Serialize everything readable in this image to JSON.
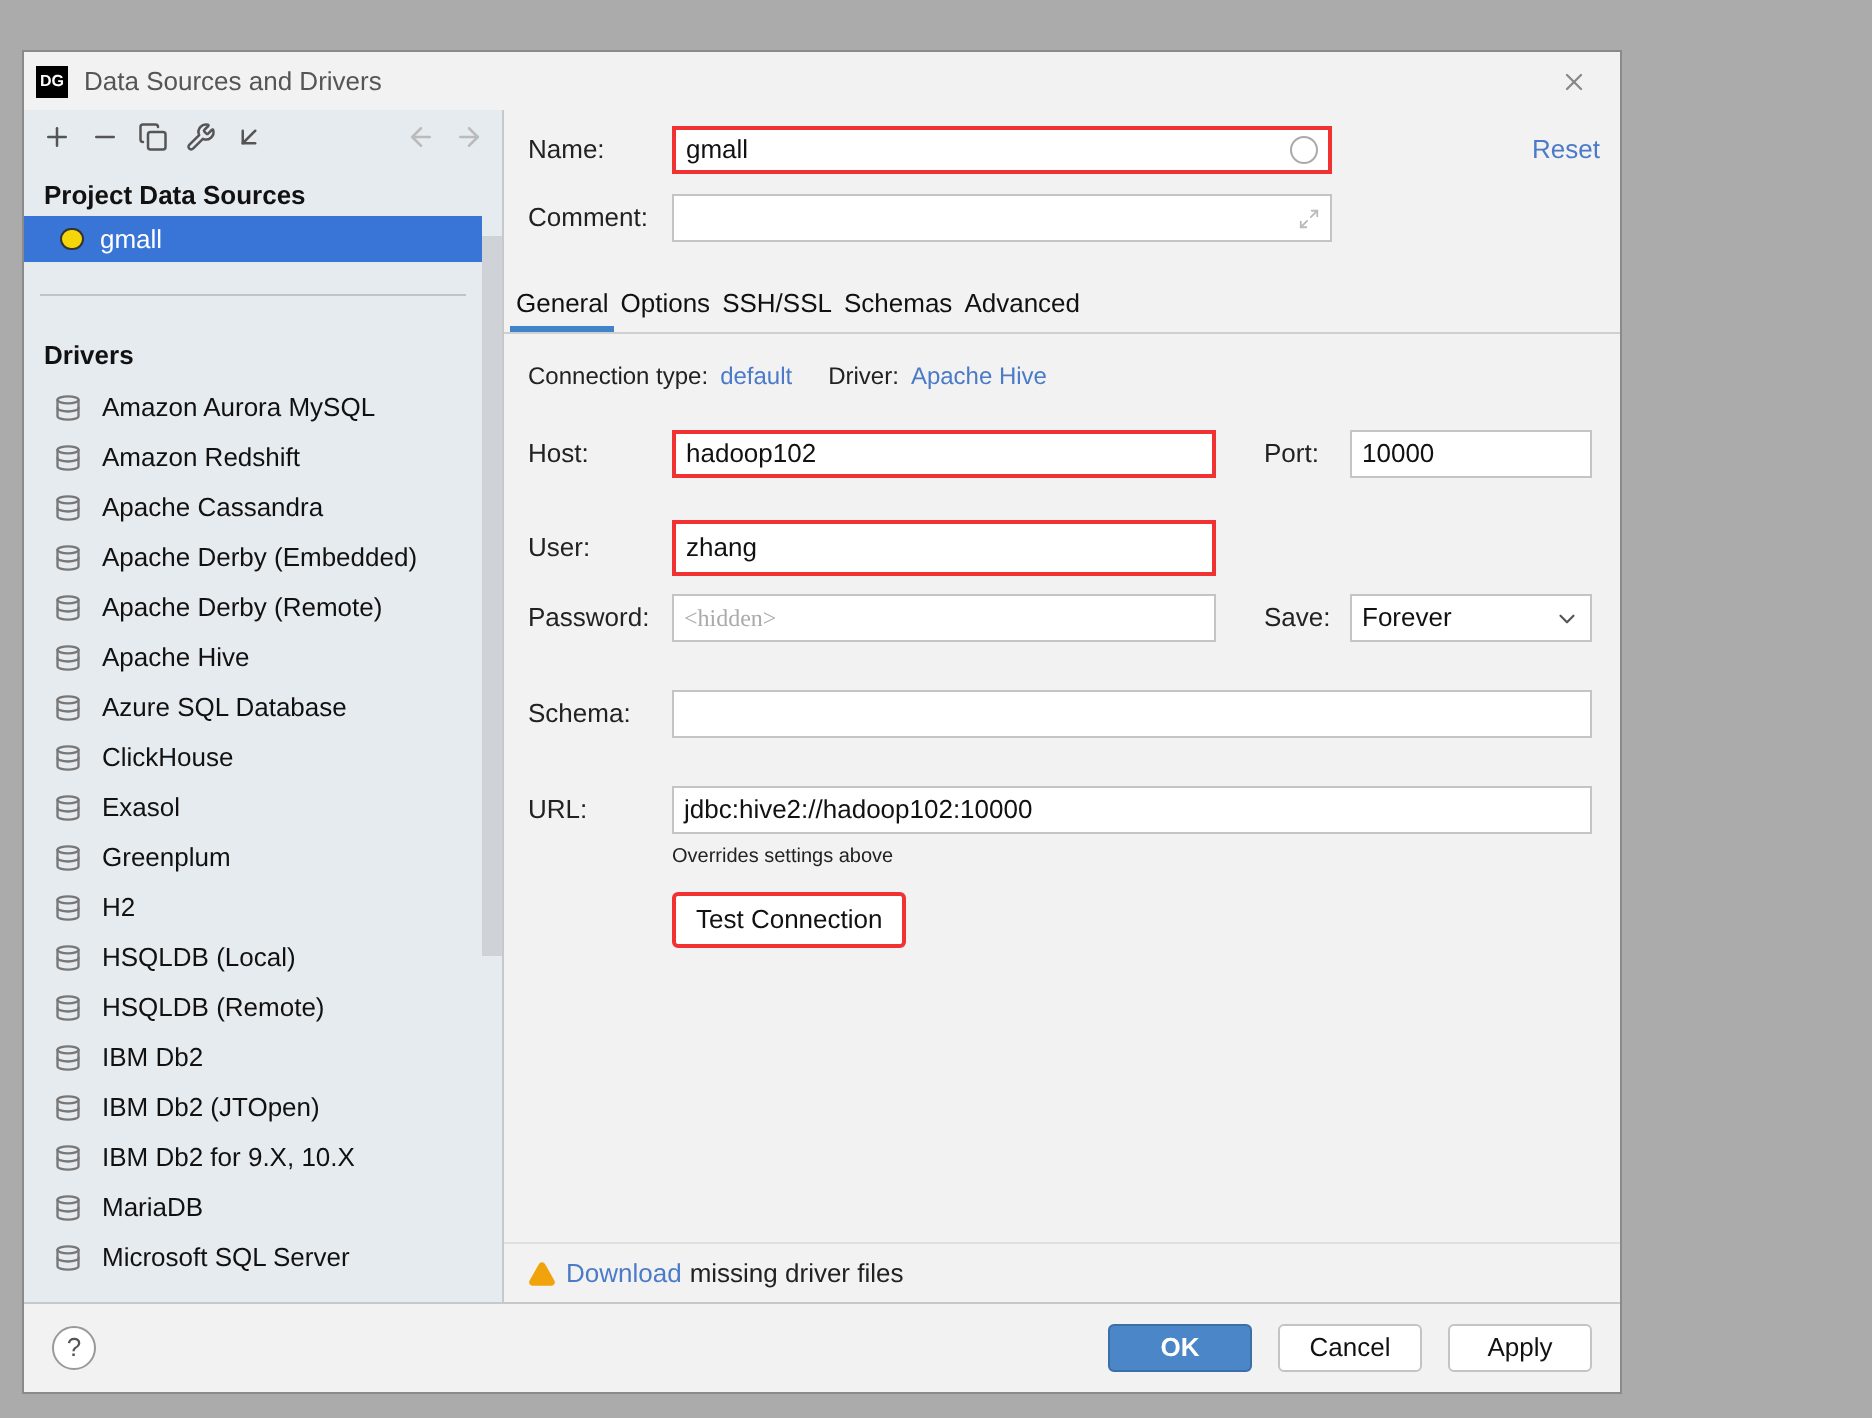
{
  "window": {
    "title": "Data Sources and Drivers",
    "logo": "DG"
  },
  "sidebar": {
    "project_heading": "Project Data Sources",
    "project_items": [
      {
        "label": "gmall",
        "selected": true
      }
    ],
    "drivers_heading": "Drivers",
    "drivers": [
      {
        "label": "Amazon Aurora MySQL"
      },
      {
        "label": "Amazon Redshift"
      },
      {
        "label": "Apache Cassandra"
      },
      {
        "label": "Apache Derby (Embedded)"
      },
      {
        "label": "Apache Derby (Remote)"
      },
      {
        "label": "Apache Hive"
      },
      {
        "label": "Azure SQL Database"
      },
      {
        "label": "ClickHouse"
      },
      {
        "label": "Exasol"
      },
      {
        "label": "Greenplum"
      },
      {
        "label": "H2"
      },
      {
        "label": "HSQLDB (Local)"
      },
      {
        "label": "HSQLDB (Remote)"
      },
      {
        "label": "IBM Db2"
      },
      {
        "label": "IBM Db2 (JTOpen)"
      },
      {
        "label": "IBM Db2 for 9.X, 10.X"
      },
      {
        "label": "MariaDB"
      },
      {
        "label": "Microsoft SQL Server"
      }
    ]
  },
  "form": {
    "name": {
      "label": "Name:",
      "value": "gmall",
      "highlighted": true
    },
    "reset": "Reset",
    "comment": {
      "label": "Comment:"
    },
    "tabs": [
      {
        "label": "General",
        "selected": true
      },
      {
        "label": "Options",
        "selected": false
      },
      {
        "label": "SSH/SSL",
        "selected": false
      },
      {
        "label": "Schemas",
        "selected": false
      },
      {
        "label": "Advanced",
        "selected": false
      }
    ],
    "connection_type_label": "Connection type:",
    "connection_type": "default",
    "driver_label": "Driver:",
    "driver": "Apache Hive",
    "host": {
      "label": "Host:",
      "value": "hadoop102",
      "highlighted": true
    },
    "port": {
      "label": "Port:",
      "value": "10000"
    },
    "user": {
      "label": "User:",
      "value": "zhang",
      "highlighted": true
    },
    "password": {
      "label": "Password:",
      "placeholder": "<hidden>"
    },
    "save": {
      "label": "Save:",
      "value": "Forever"
    },
    "schema": {
      "label": "Schema:"
    },
    "url": {
      "label": "URL:",
      "value": "jdbc:hive2://hadoop102:10000",
      "hint": "Overrides settings above"
    },
    "test_button": {
      "label": "Test Connection",
      "highlighted": true
    },
    "warning": {
      "link": "Download",
      "text": "missing driver files"
    }
  },
  "help": "?",
  "buttons": [
    {
      "label": "OK",
      "kind": "primary"
    },
    {
      "label": "Cancel",
      "kind": "default"
    },
    {
      "label": "Apply",
      "kind": "default"
    }
  ]
}
